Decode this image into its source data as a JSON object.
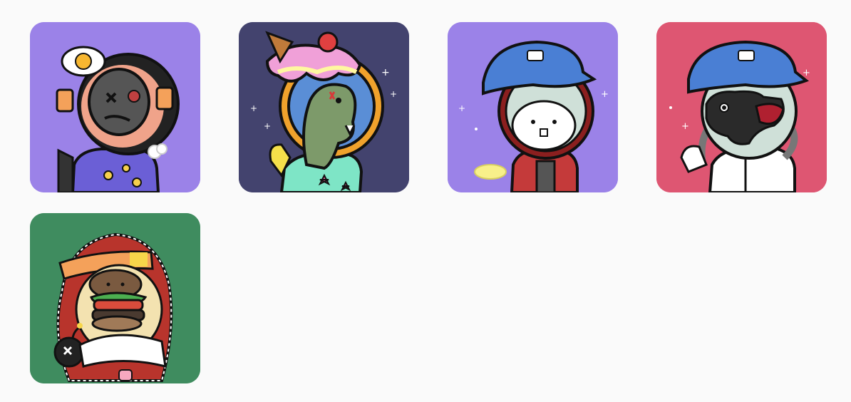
{
  "gallery": {
    "items": [
      {
        "bg": "#9b82e8",
        "icon": "scarecrow-astronaut-avatar-icon"
      },
      {
        "bg": "#43436e",
        "icon": "dinosaur-icecream-astronaut-avatar-icon"
      },
      {
        "bg": "#9b82e8",
        "icon": "hamster-cap-astronaut-avatar-icon"
      },
      {
        "bg": "#de5672",
        "icon": "dog-cap-astronaut-avatar-icon"
      },
      {
        "bg": "#3f8c5f",
        "icon": "burger-keffiyeh-astronaut-avatar-icon"
      }
    ]
  }
}
